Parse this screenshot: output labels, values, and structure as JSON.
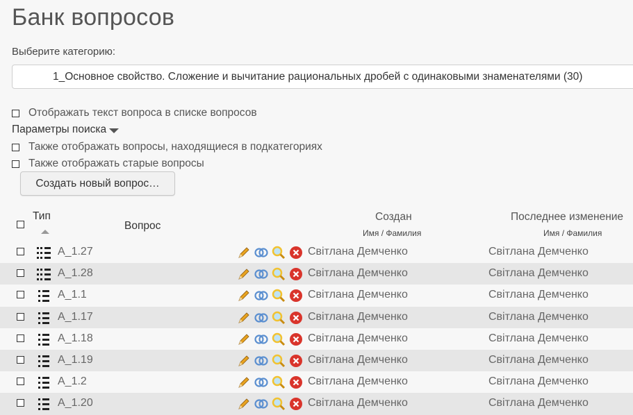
{
  "page": {
    "title": "Банк вопросов"
  },
  "category": {
    "label": "Выберите категорию:",
    "selected": "1_Основное свойство. Сложение и вычитание рациональных дробей с одинаковыми знаменателями (30)"
  },
  "options": {
    "show_question_text": "Отображать текст вопроса в списке вопросов",
    "search_params": "Параметры поиска",
    "show_subcategories": "Также отображать вопросы, находящиеся в подкатегориях",
    "show_old": "Также отображать старые вопросы"
  },
  "create_button": "Создать новый вопрос…",
  "table": {
    "headers": {
      "type": "Тип",
      "question": "Вопрос",
      "created": "Создан",
      "created_sub": "Имя / Фамилия",
      "modified": "Последнее изменение",
      "modified_sub": "Имя / Фамилия"
    },
    "rows": [
      {
        "type_icon": "multichoice-icon",
        "name": "A_1.27",
        "creator": "Світлана Демченко",
        "modifier": "Світлана Демченко"
      },
      {
        "type_icon": "multichoice-icon",
        "name": "A_1.28",
        "creator": "Світлана Демченко",
        "modifier": "Світлана Демченко"
      },
      {
        "type_icon": "singlechoice-icon",
        "name": "A_1.1",
        "creator": "Світлана Демченко",
        "modifier": "Світлана Демченко"
      },
      {
        "type_icon": "singlechoice-icon",
        "name": "A_1.17",
        "creator": "Світлана Демченко",
        "modifier": "Світлана Демченко"
      },
      {
        "type_icon": "singlechoice-icon",
        "name": "A_1.18",
        "creator": "Світлана Демченко",
        "modifier": "Світлана Демченко"
      },
      {
        "type_icon": "singlechoice-icon",
        "name": "A_1.19",
        "creator": "Світлана Демченко",
        "modifier": "Світлана Демченко"
      },
      {
        "type_icon": "singlechoice-icon",
        "name": "A_1.2",
        "creator": "Світлана Демченко",
        "modifier": "Світлана Демченко"
      },
      {
        "type_icon": "singlechoice-icon",
        "name": "A_1.20",
        "creator": "Світлана Демченко",
        "modifier": "Світлана Демченко"
      }
    ]
  },
  "colors": {
    "background": "#f7f7f7",
    "row_alt": "#e6e6e6",
    "edit_pencil": "#e8a320",
    "duplicate_blue": "#5b8fd0",
    "preview_yellow": "#f2c230",
    "delete_red": "#d9342b"
  }
}
